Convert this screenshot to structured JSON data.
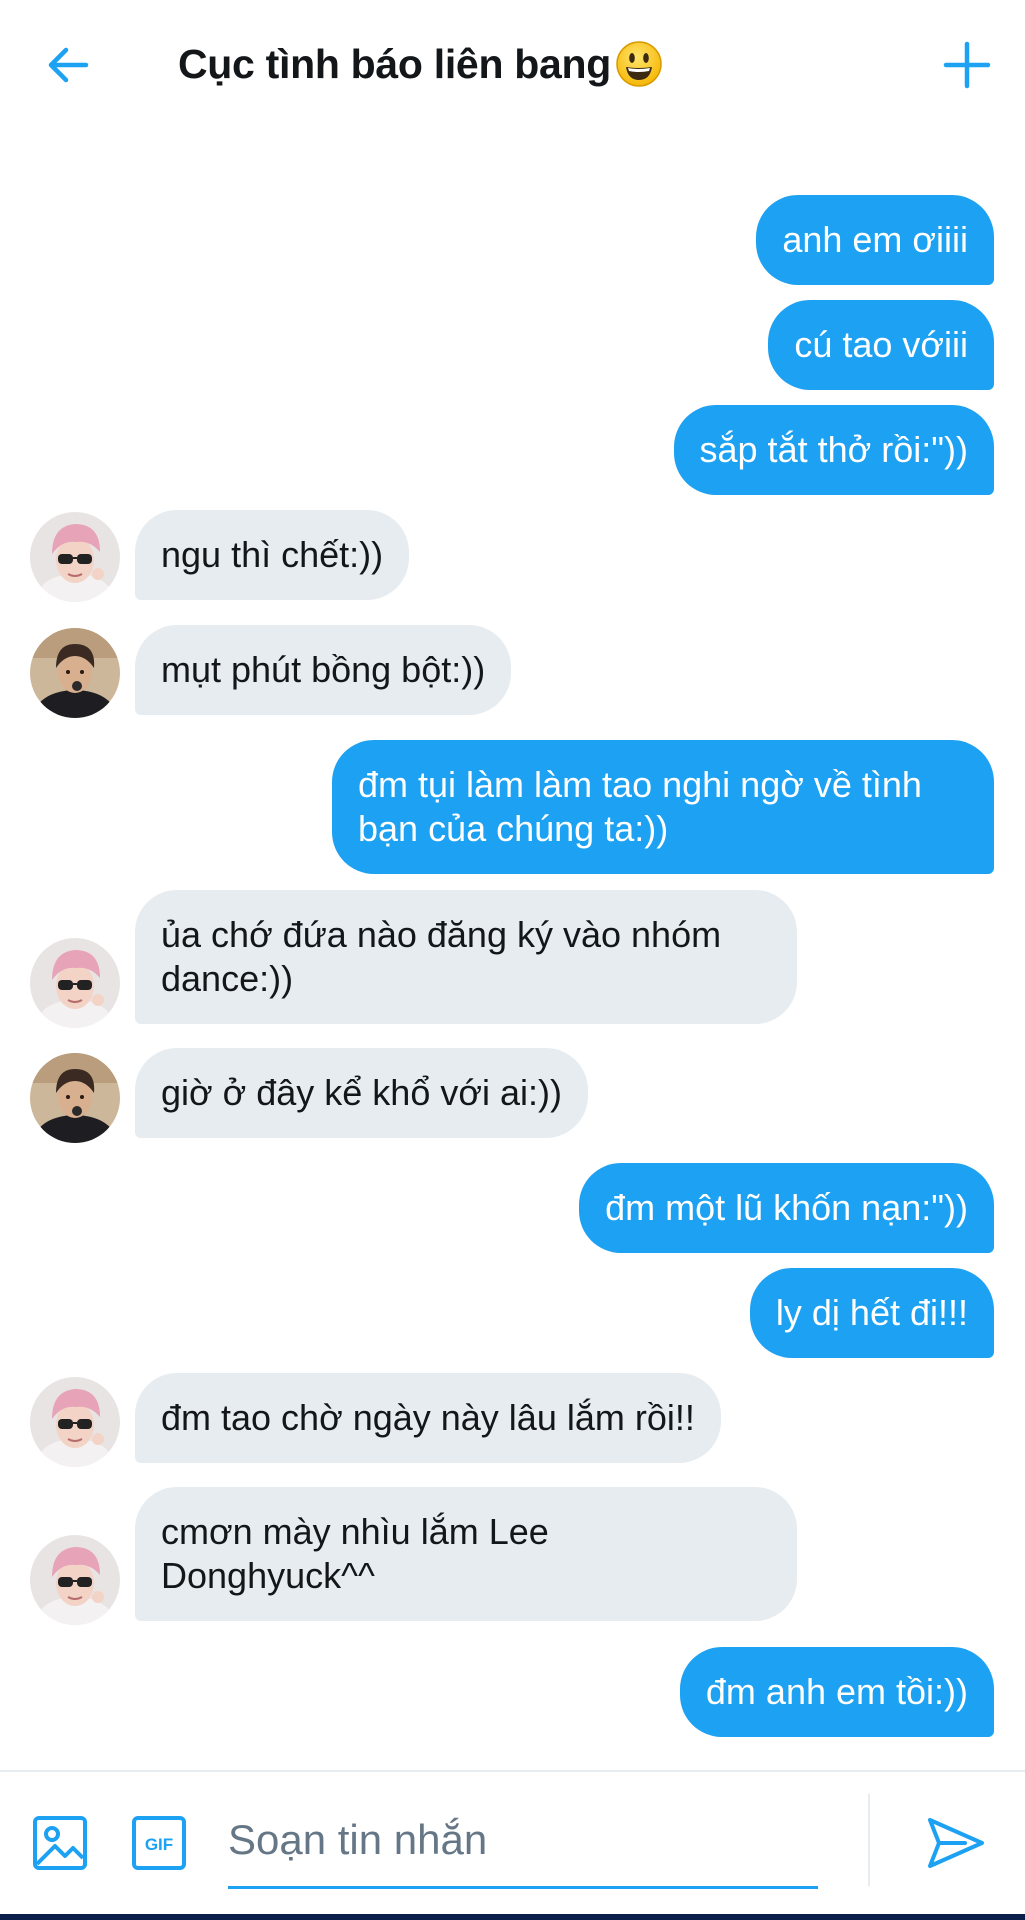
{
  "header": {
    "back_icon": "arrow-left-icon",
    "title": "Cục tình báo liên bang",
    "title_emoji": "grinning-face-emoji",
    "add_icon": "plus-icon"
  },
  "messages": [
    {
      "from": "me",
      "text": "anh em ơiiii"
    },
    {
      "from": "me",
      "text": "cú tao vớiii"
    },
    {
      "from": "me",
      "text": "sắp tắt thở rồi:\"))"
    },
    {
      "from": "them",
      "avatar": "pink-hair-avatar",
      "text": "ngu thì chết:))"
    },
    {
      "from": "them",
      "avatar": "dark-hair-avatar",
      "text": "mụt phút bồng bột:))"
    },
    {
      "from": "me",
      "text": "đm tụi làm làm tao nghi ngờ về tình bạn của chúng ta:))"
    },
    {
      "from": "them",
      "avatar": "pink-hair-avatar",
      "text": "ủa chớ đứa nào đăng ký vào nhóm dance:))"
    },
    {
      "from": "them",
      "avatar": "dark-hair-avatar",
      "text": "giờ ở đây kể khổ với ai:))"
    },
    {
      "from": "me",
      "text": "đm một lũ khốn nạn:\"))"
    },
    {
      "from": "me",
      "text": "ly dị hết đi!!!"
    },
    {
      "from": "them",
      "avatar": "pink-hair-avatar",
      "text": "đm tao chờ ngày này lâu lắm rồi!!"
    },
    {
      "from": "them",
      "avatar": "pink-hair-avatar",
      "text": "cmơn mày nhìu lắm Lee Donghyuck^^"
    },
    {
      "from": "me",
      "text": "đm anh em tồi:))"
    }
  ],
  "composer": {
    "image_icon": "image-icon",
    "gif_icon": "gif-icon",
    "gif_label": "GIF",
    "placeholder": "Soạn tin nhắn",
    "value": "",
    "send_icon": "send-icon"
  },
  "colors": {
    "accent": "#1da1f2",
    "incoming_bubble": "#e6ecf0",
    "text": "#14171a",
    "placeholder": "#657786"
  }
}
